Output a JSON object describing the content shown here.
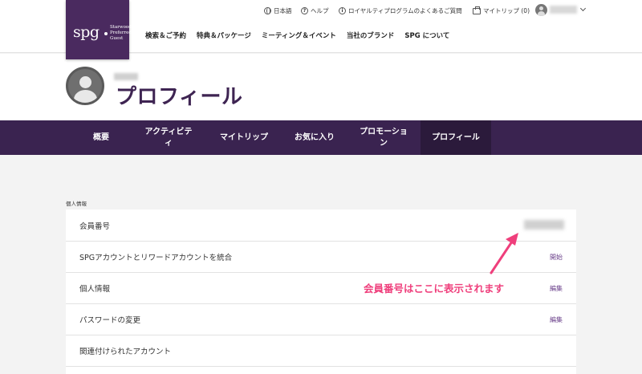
{
  "header": {
    "logo": {
      "text": "spg",
      "sub_line1": "Starwood",
      "sub_line2": "Preferred",
      "sub_line3": "Guest"
    },
    "utility": {
      "language": "日本語",
      "help": "ヘルプ",
      "faq": "ロイヤルティプログラムのよくあるご質問",
      "my_trips": "マイトリップ (0)"
    },
    "main_nav": [
      "検索＆ご予約",
      "特典＆パッケージ",
      "ミーティング＆イベント",
      "当社のブランド",
      "SPG について"
    ]
  },
  "profile": {
    "title": "プロフィール"
  },
  "subnav": {
    "tabs": [
      {
        "label": "概要",
        "active": false
      },
      {
        "label": "アクティビティ",
        "active": false
      },
      {
        "label": "マイトリップ",
        "active": false
      },
      {
        "label": "お気に入り",
        "active": false
      },
      {
        "label": "プロモーション",
        "active": false
      },
      {
        "label": "プロフィール",
        "active": true
      }
    ]
  },
  "content": {
    "section_label": "個人情報",
    "rows": [
      {
        "label": "会員番号",
        "action": ""
      },
      {
        "label": "SPGアカウントとリワードアカウントを統合",
        "action": "開始"
      },
      {
        "label": "個人情報",
        "action": "編集"
      },
      {
        "label": "パスワードの変更",
        "action": "編集"
      },
      {
        "label": "関連付けられたアカウント",
        "action": ""
      }
    ],
    "annotation": "会員番号はここに表示されます"
  },
  "colors": {
    "brand_purple": "#4a2a5f",
    "nav_purple": "#3a2350",
    "active_tab": "#2b1a3b",
    "annotation_pink": "#ef3f7c",
    "link_purple": "#6a3f8a"
  }
}
